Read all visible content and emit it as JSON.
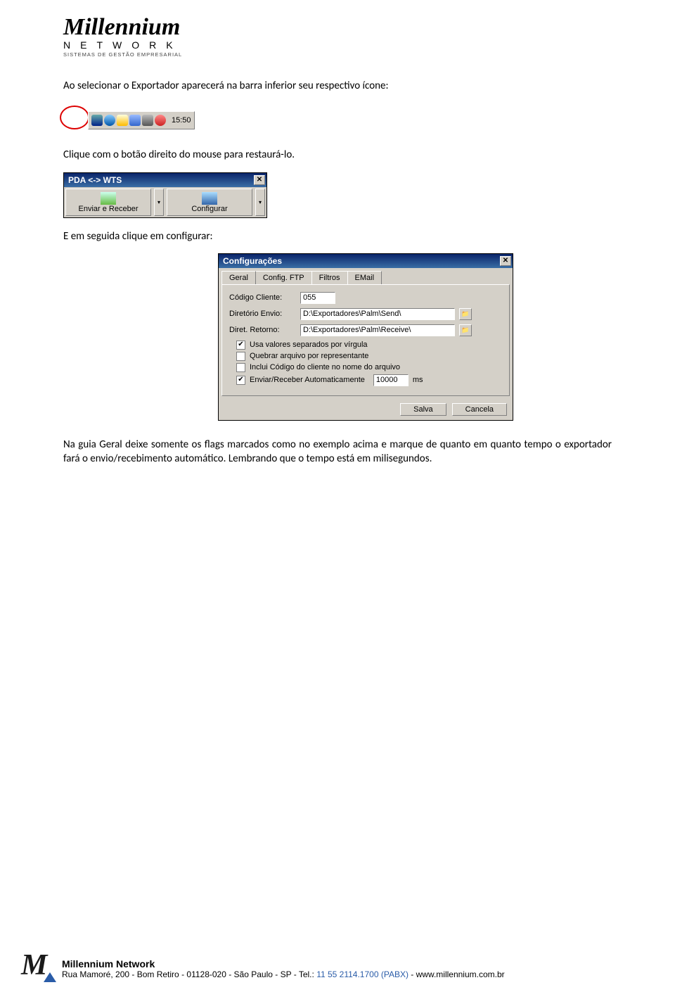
{
  "header": {
    "brand": "Millennium",
    "sub1": "NETWORK",
    "sub2": "SISTEMAS DE GESTÃO EMPRESARIAL"
  },
  "paragraphs": {
    "p1": "Ao selecionar o Exportador aparecerá na barra inferior seu respectivo ícone:",
    "p2": "Clique com o botão direito do mouse para restaurá-lo.",
    "p3": "E em seguida clique em configurar:",
    "p4": "Na guia Geral deixe somente os flags marcados como no exemplo acima e marque de quanto em quanto tempo o exportador fará o envio/recebimento automático. Lembrando que o tempo está em milisegundos."
  },
  "systray": {
    "time": "15:50"
  },
  "pda": {
    "title": "PDA <-> WTS",
    "btn1": "Enviar e Receber",
    "btn2": "Configurar"
  },
  "config": {
    "title": "Configurações",
    "tabs": {
      "geral": "Geral",
      "ftp": "Config. FTP",
      "filtros": "Filtros",
      "email": "EMail"
    },
    "fields": {
      "codigo_label": "Código Cliente:",
      "codigo_value": "055",
      "dir_envio_label": "Diretório Envio:",
      "dir_envio_value": "D:\\Exportadores\\Palm\\Send\\",
      "dir_ret_label": "Diret. Retorno:",
      "dir_ret_value": "D:\\Exportadores\\Palm\\Receive\\",
      "cb1": "Usa valores separados por vírgula",
      "cb2": "Quebrar arquivo por representante",
      "cb3": "Inclui Código do cliente no nome do arquivo",
      "cb4": "Enviar/Receber Automaticamente",
      "interval": "10000",
      "ms": "ms"
    },
    "buttons": {
      "salva": "Salva",
      "cancela": "Cancela"
    }
  },
  "footer": {
    "company": "Millennium Network",
    "addr_a": "Rua Mamoré, 200 - Bom Retiro - 01128-020 - São Paulo - SP - Tel.: ",
    "addr_b": "11 55 2114.1700 (PABX)",
    "addr_c": " - www.millennium.com.br"
  }
}
